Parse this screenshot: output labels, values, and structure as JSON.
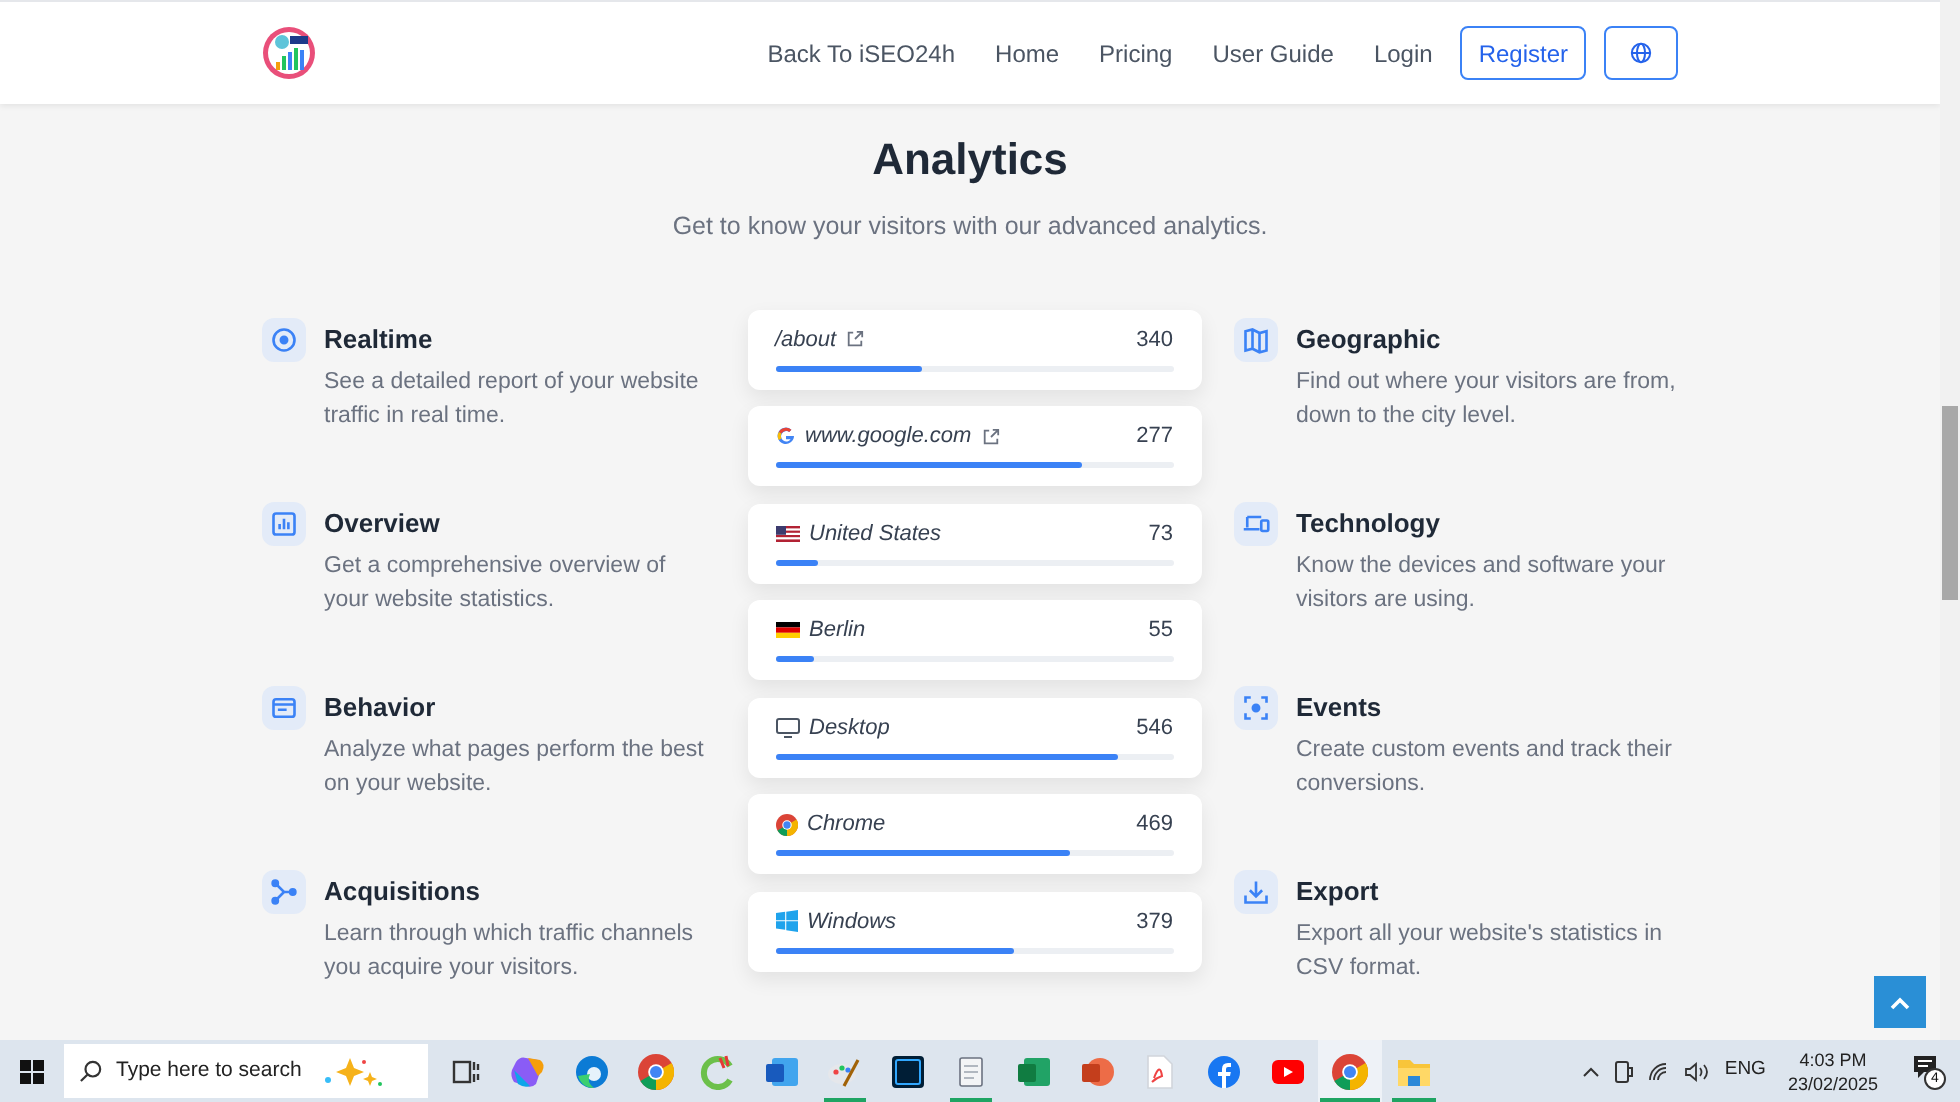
{
  "nav": {
    "links": [
      "Back To iSEO24h",
      "Home",
      "Pricing",
      "User Guide",
      "Login"
    ],
    "register": "Register"
  },
  "section": {
    "title": "Analytics",
    "subtitle": "Get to know your visitors with our advanced analytics."
  },
  "features_left": [
    {
      "kind": "target",
      "title": "Realtime",
      "text": "See a detailed report of your website traffic in real time."
    },
    {
      "kind": "chart",
      "title": "Overview",
      "text": "Get a comprehensive overview of your website statistics."
    },
    {
      "kind": "window",
      "title": "Behavior",
      "text": "Analyze what pages perform the best on your website."
    },
    {
      "kind": "branch",
      "title": "Acquisitions",
      "text": "Learn through which traffic channels you acquire your visitors."
    }
  ],
  "features_right": [
    {
      "kind": "map",
      "title": "Geographic",
      "text": "Find out where your visitors are from, down to the city level."
    },
    {
      "kind": "devices",
      "title": "Technology",
      "text": "Know the devices and software your visitors are using."
    },
    {
      "kind": "focus",
      "title": "Events",
      "text": "Create custom events and track their conversions."
    },
    {
      "kind": "download",
      "title": "Export",
      "text": "Export all your website's statistics in CSV format."
    }
  ],
  "stats": [
    {
      "kind": "page",
      "label": "/about",
      "external": true,
      "value": "340",
      "level": 0.37
    },
    {
      "kind": "google",
      "label": "www.google.com",
      "external": true,
      "value": "277",
      "level": 0.77
    },
    {
      "kind": "flag-us",
      "label": "United States",
      "external": false,
      "value": "73",
      "level": 0.11
    },
    {
      "kind": "flag-de",
      "label": "Berlin",
      "external": false,
      "value": "55",
      "level": 0.1
    },
    {
      "kind": "desktop",
      "label": "Desktop",
      "external": false,
      "value": "546",
      "level": 0.86
    },
    {
      "kind": "chrome",
      "label": "Chrome",
      "external": false,
      "value": "469",
      "level": 0.74
    },
    {
      "kind": "windows",
      "label": "Windows",
      "external": false,
      "value": "379",
      "level": 0.6
    }
  ],
  "taskbar": {
    "search_placeholder": "Type here to search",
    "apps": [
      {
        "kind": "taskview",
        "running": false,
        "selected": false
      },
      {
        "kind": "copilot",
        "running": false,
        "selected": false
      },
      {
        "kind": "edge",
        "running": false,
        "selected": false
      },
      {
        "kind": "chrome",
        "running": false,
        "selected": false
      },
      {
        "kind": "cleaner",
        "running": false,
        "selected": false
      },
      {
        "kind": "word",
        "running": false,
        "selected": false
      },
      {
        "kind": "paint",
        "running": true,
        "selected": false
      },
      {
        "kind": "photoshop",
        "running": false,
        "selected": false
      },
      {
        "kind": "notepad",
        "running": true,
        "selected": false
      },
      {
        "kind": "excel",
        "running": false,
        "selected": false
      },
      {
        "kind": "powerpoint",
        "running": false,
        "selected": false
      },
      {
        "kind": "pdf",
        "running": false,
        "selected": false
      },
      {
        "kind": "facebook",
        "running": false,
        "selected": false
      },
      {
        "kind": "youtube",
        "running": false,
        "selected": false
      },
      {
        "kind": "chrome",
        "running": true,
        "selected": true
      },
      {
        "kind": "explorer",
        "running": true,
        "selected": false
      }
    ],
    "language": "ENG",
    "time": "4:03 PM",
    "date": "23/02/2025",
    "notifications": "4"
  }
}
